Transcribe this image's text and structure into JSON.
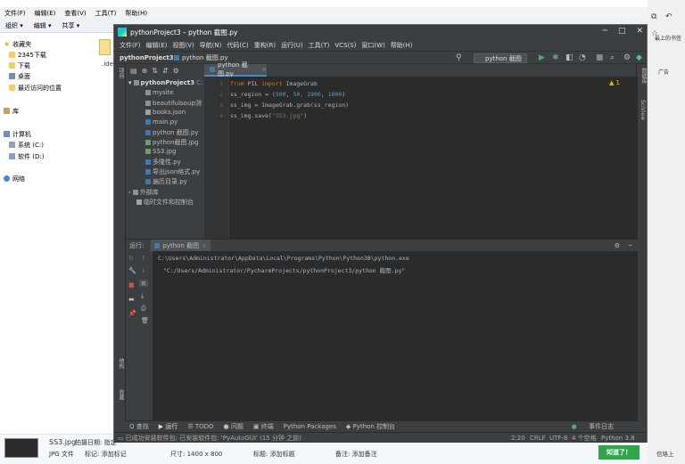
{
  "explorer": {
    "menu": [
      "文件(F)",
      "编辑(E)",
      "查看(V)",
      "工具(T)",
      "帮助(H)"
    ],
    "toolbar": [
      "组织 ▾",
      "编辑 ▾",
      "共享 ▾"
    ],
    "nav": [
      "收藏夹",
      "2345下载",
      "下载",
      "桌面",
      "最近访问的位置",
      "库",
      "计算机",
      "系统 (C:)",
      "软件 (D:)",
      "网络"
    ],
    "file_ext": ".ide",
    "details": {
      "name": "SS3.jpg",
      "type": "JPG 文件",
      "date": "拍摄日期: 指定",
      "tags": "标记: 添加标记",
      "size": "尺寸: 1400 x 800",
      "title": "标题: 添加标题",
      "note": "备注: 添加备注"
    }
  },
  "right_strip": {
    "label1": "最上的书签",
    "label2": "广告",
    "notify": "知道了！",
    "login": "信珞上"
  },
  "pycharm": {
    "title": "pythonProject3 – python 截图.py",
    "menu": [
      "文件(F)",
      "编辑(E)",
      "视图(V)",
      "导航(N)",
      "代码(C)",
      "重构(R)",
      "运行(U)",
      "工具(T)",
      "VCS(S)",
      "窗口(W)",
      "帮助(H)"
    ],
    "breadcrumb": {
      "project": "pythonProject3",
      "file": "python 截图.py"
    },
    "run_config": "python 截图",
    "side_labels": {
      "project": "项目",
      "structure": "结构",
      "favorites": "收藏",
      "database": "数据库",
      "sciview": "SciView"
    },
    "tree": {
      "root": "pythonProject3",
      "root_path": "C:",
      "items": [
        "mysite",
        "beautifulsoup测",
        "books.json",
        "main.py",
        "python 截图.py",
        "python截图.jpg",
        "SS3.jpg",
        "多隆性.py",
        "导出json格式.py",
        "遍历目录.py"
      ],
      "ext": "外部库",
      "scratch": "临时文件和控制台"
    },
    "tab": "python 截图.py",
    "line_numbers": [
      "1",
      "2",
      "3",
      "4"
    ],
    "code": {
      "l1": {
        "k1": "from",
        "m1": " PIL ",
        "k2": "import",
        "m2": " ImageGrab"
      },
      "l2": {
        "a": "ss_region = (",
        "n1": "500",
        "b": ", ",
        "n2": "5",
        "c": "0, ",
        "n3": "1900",
        "d": ", ",
        "n4": "1000",
        "e": ")"
      },
      "l3": "ss_img = ImageGrab.grab(ss_region)",
      "l4": {
        "a": "ss_img.save(",
        "s": "\"SS3.jpg\"",
        "b": ")"
      }
    },
    "warning": "▲ 1",
    "run_tab_label": "运行:",
    "run_tab": "python 截图",
    "console": [
      "C:\\Users\\Administrator\\AppData\\Local\\Programs\\Python\\Python38\\python.exe",
      "\"C:/Users/Administrator/PycharmProjects/pythonProject3/python 截图.py\""
    ],
    "bottom_tools": [
      "Q 查找",
      "▶ 运行",
      "☰ TODO",
      "● 问题",
      "▣ 终端",
      "Python Packages",
      "◆ Python 控制台"
    ],
    "event_log": "事件日志",
    "status_msg": "已成功安装软件包: 已安装软件包: 'PyAutoGUI' (15 分钟 之前)",
    "status_right": [
      "2:20",
      "CRLF",
      "UTF-8",
      "4 个空格",
      "Python 3.8"
    ]
  }
}
